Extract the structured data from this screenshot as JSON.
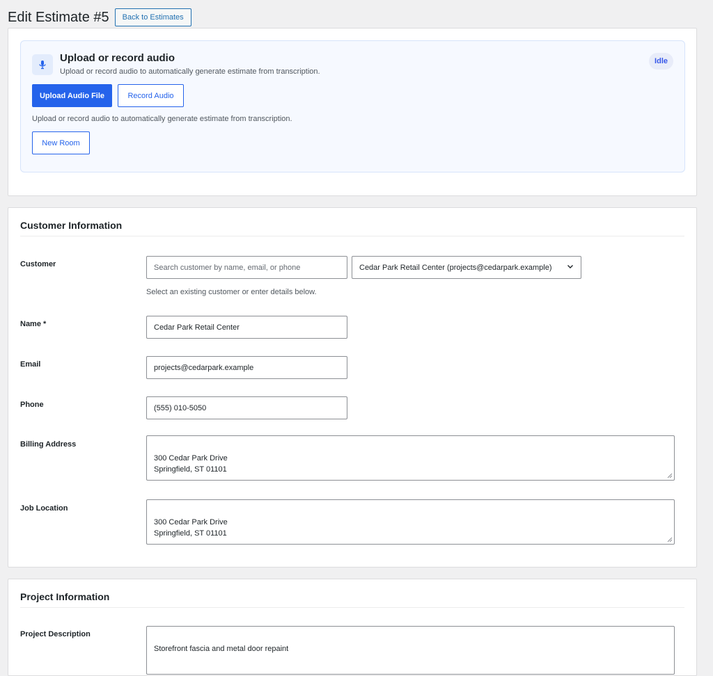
{
  "header": {
    "title": "Edit Estimate #5",
    "back_label": "Back to Estimates"
  },
  "audio": {
    "title": "Upload or record audio",
    "subtitle": "Upload or record audio to automatically generate estimate from transcription.",
    "status": "Idle",
    "upload_label": "Upload Audio File",
    "record_label": "Record Audio",
    "help": "Upload or record audio to automatically generate estimate from transcription.",
    "new_room_label": "New Room",
    "mic_icon": "microphone-icon"
  },
  "customer_section": {
    "title": "Customer Information",
    "customer_label": "Customer",
    "search_placeholder": "Search customer by name, email, or phone",
    "selected_customer": "Cedar Park Retail Center (projects@cedarpark.example)",
    "help": "Select an existing customer or enter details below.",
    "name_label": "Name *",
    "name_value": "Cedar Park Retail Center",
    "email_label": "Email",
    "email_value": "projects@cedarpark.example",
    "phone_label": "Phone",
    "phone_value": "(555) 010-5050",
    "billing_label": "Billing Address",
    "billing_value": "300 Cedar Park Drive\nSpringfield, ST 01101",
    "job_label": "Job Location",
    "job_value": "300 Cedar Park Drive\nSpringfield, ST 01101"
  },
  "project_section": {
    "title": "Project Information",
    "description_label": "Project Description",
    "description_value": "Storefront fascia and metal door repaint"
  },
  "colors": {
    "accent": "#2563eb",
    "page_bg": "#f0f0f1",
    "audio_panel_bg": "#f6f9ff",
    "badge_bg": "#e8ecf9"
  }
}
